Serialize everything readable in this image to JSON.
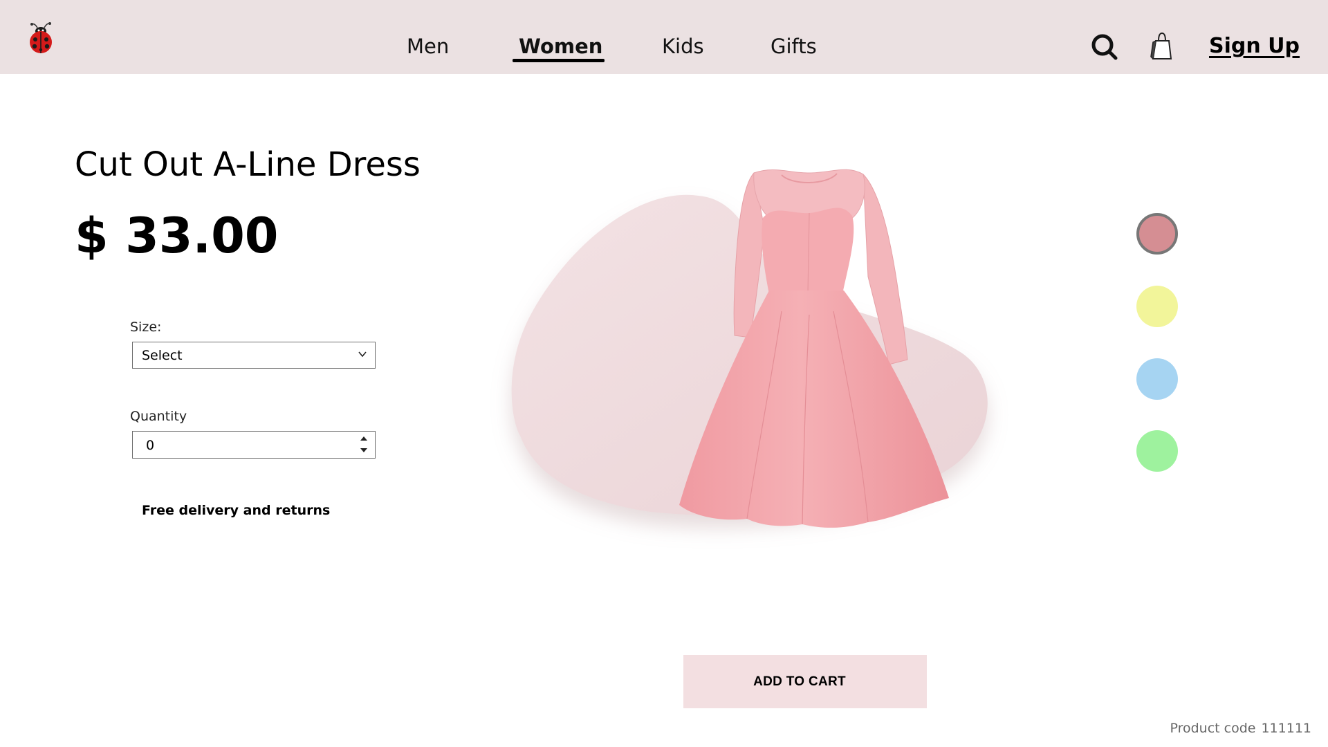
{
  "header": {
    "logo_icon": "ladybug-icon",
    "nav": [
      {
        "label": "Men",
        "active": false
      },
      {
        "label": "Women",
        "active": true
      },
      {
        "label": "Kids",
        "active": false
      },
      {
        "label": "Gifts",
        "active": false
      }
    ],
    "search_icon": "search-icon",
    "bag_icon": "shopping-bag-icon",
    "signup_label": "Sign Up"
  },
  "product": {
    "title": "Cut Out A-Line Dress",
    "price": "$ 33.00",
    "size_label": "Size:",
    "size_value": "Select",
    "quantity_label": "Quantity",
    "quantity_value": "0",
    "delivery_note": "Free delivery and returns",
    "code_label": "Product code",
    "code_value": "111111",
    "image_subject": "pink lace-sleeve A-line dress"
  },
  "colors": [
    {
      "name": "rose",
      "hex": "#d58e93",
      "selected": true
    },
    {
      "name": "yellow",
      "hex": "#f2f59a",
      "selected": false
    },
    {
      "name": "blue",
      "hex": "#a6d4f2",
      "selected": false
    },
    {
      "name": "green",
      "hex": "#9ef29e",
      "selected": false
    }
  ],
  "cart": {
    "button_label": "ADD TO CART",
    "button_bg": "#f3dfe1"
  },
  "theme": {
    "navbar_bg": "#ebe1e2",
    "dress_pink": "#f2a6ab",
    "blob_pink": "#efdadd"
  }
}
